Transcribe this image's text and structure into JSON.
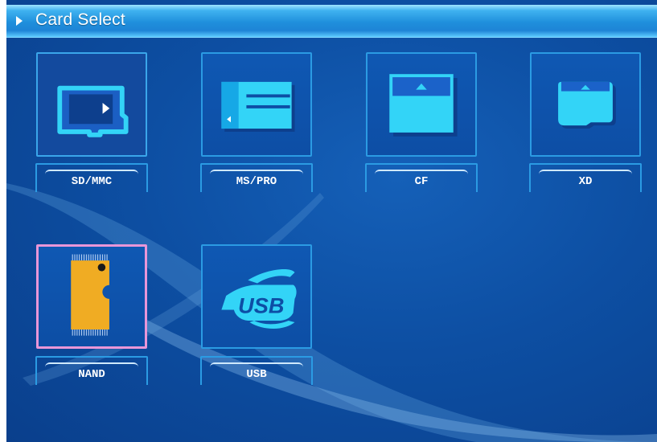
{
  "header": {
    "title": "Card Select"
  },
  "cards": [
    {
      "id": "sd",
      "label": "SD/MMC"
    },
    {
      "id": "ms",
      "label": "MS/PRO"
    },
    {
      "id": "cf",
      "label": "CF"
    },
    {
      "id": "xd",
      "label": "XD"
    },
    {
      "id": "nand",
      "label": "NAND"
    },
    {
      "id": "usb",
      "label": "USB"
    }
  ],
  "usb_logo_text": "USB",
  "colors": {
    "background": "#0d4ea5",
    "titlebar": "#1f8fdc",
    "tile_border": "#2b9be3",
    "focus_border": "#e996d8",
    "card_cyan": "#33d4f7",
    "nand_orange": "#f0ac23"
  }
}
